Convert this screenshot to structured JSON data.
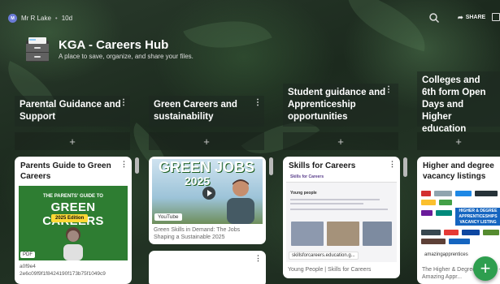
{
  "topbar": {
    "user_initials": "M",
    "user_name": "Mr R Lake",
    "separator": "•",
    "time_ago": "10d",
    "share_label": "SHARE"
  },
  "header": {
    "title": "KGA - Careers Hub",
    "subtitle": "A place to save, organize, and share your files."
  },
  "columns": [
    {
      "title": "Parental Guidance and Support"
    },
    {
      "title": "Green Careers and sustainability"
    },
    {
      "title": "Student guidance and Apprenticeship opportunities"
    },
    {
      "title": "Colleges and 6th form Open Days and Higher education"
    }
  ],
  "add_symbol": "+",
  "menu_symbol": "⋮",
  "cards": [
    {
      "title": "Parents Guide to Green Careers",
      "thumb_line1": "THE PARENTS' GUIDE TO",
      "thumb_line2": "GREEN CAREERS",
      "thumb_badge": "2025 Edition",
      "type_label": "PDF",
      "meta1": "a0f9e4",
      "meta2": "2e6c09f9f1f8424190f173b75f1049c9"
    },
    {
      "thumb_title": "GREEN JOBS",
      "thumb_year": "2025",
      "type_label": "YouTube",
      "description": "Green Skills in Demand: The Jobs Shaping a Sustainable 2025"
    },
    {
      "title": "Skills for Careers",
      "thumb_brand": "Skills for Careers",
      "thumb_heading": "Young people",
      "url_label": "skillsforcareers.education.g...",
      "description": "Young People | Skills for Careers"
    },
    {
      "title": "Higher and degree vacancy listings",
      "thumb_box": "HIGHER & DEGREE APPRENTICESHIPS VACANCY LISTING",
      "url_label": "amazingapprentices",
      "description": "The Higher & Degree ... back! - Amazing Appr..."
    }
  ],
  "fab_label": "+",
  "colors": {
    "fab": "#2e9e4f",
    "avatar": "#6b7bd6",
    "green_thumb": "#2e7d32"
  }
}
